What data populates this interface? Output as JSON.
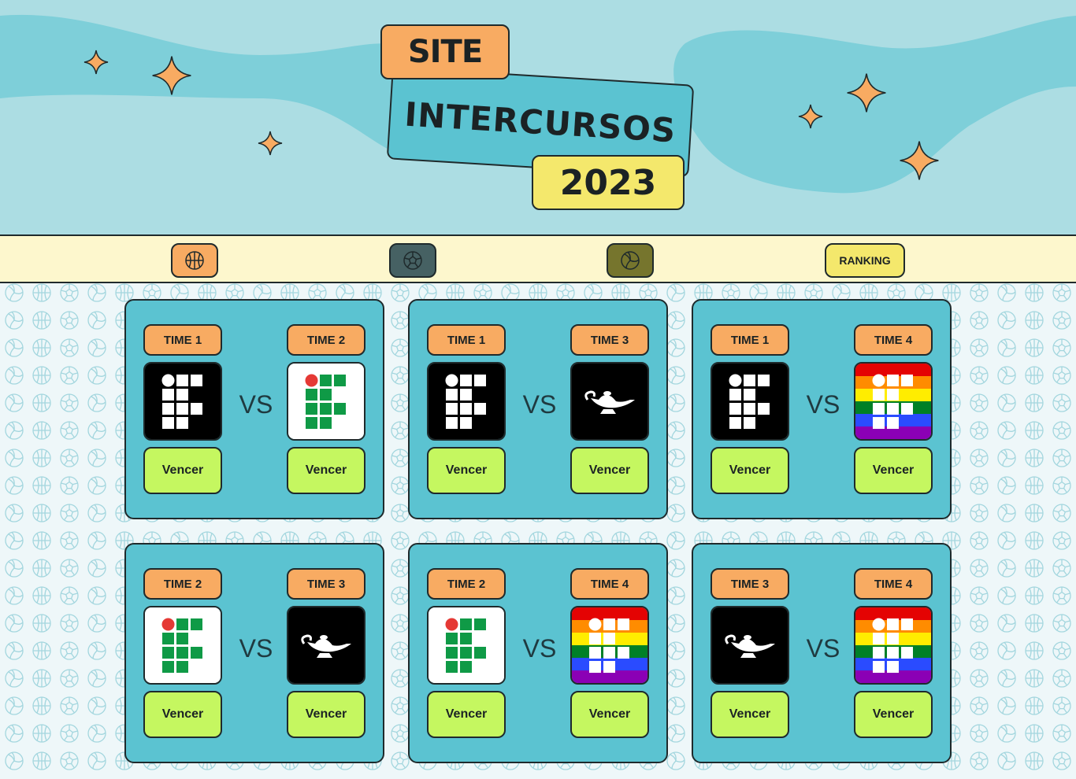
{
  "header": {
    "title_line1": "SITE",
    "title_line2": "INTERCURSOS",
    "title_line3": "2023"
  },
  "nav": {
    "items": [
      {
        "icon": "basketball-icon"
      },
      {
        "icon": "soccer-ball-icon"
      },
      {
        "icon": "volleyball-icon"
      },
      {
        "label": "RANKING"
      }
    ]
  },
  "vs_label": "VS",
  "win_label": "Vencer",
  "matches": [
    {
      "team_a": "TIME 1",
      "logo_a": "black",
      "team_b": "TIME 2",
      "logo_b": "white"
    },
    {
      "team_a": "TIME 1",
      "logo_a": "black",
      "team_b": "TIME 3",
      "logo_b": "lamp"
    },
    {
      "team_a": "TIME 1",
      "logo_a": "black",
      "team_b": "TIME 4",
      "logo_b": "rainbow"
    },
    {
      "team_a": "TIME 2",
      "logo_a": "white",
      "team_b": "TIME 3",
      "logo_b": "lamp"
    },
    {
      "team_a": "TIME 2",
      "logo_a": "white",
      "team_b": "TIME 4",
      "logo_b": "rainbow"
    },
    {
      "team_a": "TIME 3",
      "logo_a": "lamp",
      "team_b": "TIME 4",
      "logo_b": "rainbow"
    }
  ],
  "colors": {
    "header_bg": "#acdde3",
    "wave": "#7ecfd9",
    "card": "#5bc3d1",
    "label": "#f8ab62",
    "button": "#c5f760",
    "nav_bg": "#fdf7cd"
  }
}
